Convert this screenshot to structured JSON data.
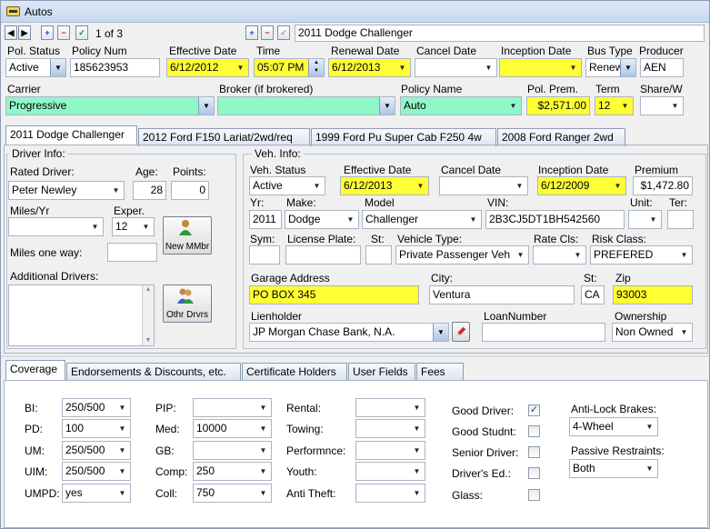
{
  "window": {
    "title": "Autos"
  },
  "nav": {
    "record_counter": "1 of 3",
    "vehicle_title": "2011 Dodge Challenger"
  },
  "policy": {
    "pol_status": {
      "label": "Pol. Status",
      "value": "Active"
    },
    "policy_num": {
      "label": "Policy Num",
      "value": "185623953"
    },
    "effective_date": {
      "label": "Effective Date",
      "value": "6/12/2012"
    },
    "time": {
      "label": "Time",
      "value": "05:07 PM"
    },
    "renewal_date": {
      "label": "Renewal Date",
      "value": "6/12/2013"
    },
    "cancel_date": {
      "label": "Cancel Date",
      "value": ""
    },
    "inception_date": {
      "label": "Inception Date",
      "value": ""
    },
    "bus_type": {
      "label": "Bus Type",
      "value": "Renew"
    },
    "producer": {
      "label": "Producer",
      "value": "AEN"
    },
    "carrier": {
      "label": "Carrier",
      "value": "Progressive"
    },
    "broker": {
      "label": "Broker (if brokered)",
      "value": ""
    },
    "policy_name": {
      "label": "Policy Name",
      "value": "Auto"
    },
    "pol_prem": {
      "label": "Pol. Prem.",
      "value": "$2,571.00"
    },
    "term": {
      "label": "Term",
      "value": "12"
    },
    "share": {
      "label": "Share/W",
      "value": ""
    }
  },
  "vehicle_tabs": [
    "2011 Dodge Challenger",
    "2012 Ford F150 Lariat/2wd/req",
    "1999 Ford Pu Super Cab F250 4w",
    "2008 Ford Ranger 2wd"
  ],
  "driver": {
    "group_title": "Driver Info:",
    "rated_driver": {
      "label": "Rated Driver:",
      "value": "Peter Newley"
    },
    "age": {
      "label": "Age:",
      "value": "28"
    },
    "points": {
      "label": "Points:",
      "value": "0"
    },
    "miles_yr": {
      "label": "Miles/Yr",
      "value": ""
    },
    "exper": {
      "label": "Exper.",
      "value": "12"
    },
    "new_mmbr_button": "New MMbr",
    "miles_one_way": {
      "label": "Miles one way:",
      "value": ""
    },
    "additional_drivers_label": "Additional Drivers:",
    "othr_drvrs_button": "Othr Drvrs"
  },
  "vehicle": {
    "group_title": "Veh. Info:",
    "veh_status": {
      "label": "Veh. Status",
      "value": "Active"
    },
    "effective_date": {
      "label": "Effective Date",
      "value": "6/12/2013"
    },
    "cancel_date": {
      "label": "Cancel Date",
      "value": ""
    },
    "inception_date": {
      "label": "Inception Date",
      "value": "6/12/2009"
    },
    "premium": {
      "label": "Premium",
      "value": "$1,472.80"
    },
    "yr": {
      "label": "Yr:",
      "value": "2011"
    },
    "make": {
      "label": "Make:",
      "value": "Dodge"
    },
    "model": {
      "label": "Model",
      "value": "Challenger"
    },
    "vin": {
      "label": "VIN:",
      "value": "2B3CJ5DT1BH542560"
    },
    "unit": {
      "label": "Unit:",
      "value": ""
    },
    "ter": {
      "label": "Ter:",
      "value": ""
    },
    "sym": {
      "label": "Sym:",
      "value": ""
    },
    "license_plate": {
      "label": "License Plate:",
      "value": ""
    },
    "st": {
      "label": "St:",
      "value": ""
    },
    "vehicle_type": {
      "label": "Vehicle Type:",
      "value": "Private Passenger Veh"
    },
    "rate_cls": {
      "label": "Rate Cls:",
      "value": ""
    },
    "risk_class": {
      "label": "Risk Class:",
      "value": "PREFERED"
    },
    "garage_address": {
      "label": "Garage Address",
      "value": "PO BOX 345"
    },
    "city": {
      "label": "City:",
      "value": "Ventura"
    },
    "garage_st": {
      "label": "St:",
      "value": "CA"
    },
    "zip": {
      "label": "Zip",
      "value": "93003"
    },
    "lienholder": {
      "label": "Lienholder",
      "value": "JP Morgan Chase Bank, N.A."
    },
    "loan_number": {
      "label": "LoanNumber",
      "value": ""
    },
    "ownership": {
      "label": "Ownership",
      "value": "Non Owned"
    }
  },
  "bottom_tabs": [
    "Coverage",
    "Endorsements & Discounts, etc.",
    "Certificate Holders",
    "User Fields",
    "Fees"
  ],
  "coverage": {
    "col1": [
      {
        "label": "BI:",
        "value": "250/500"
      },
      {
        "label": "PD:",
        "value": "100"
      },
      {
        "label": "UM:",
        "value": "250/500"
      },
      {
        "label": "UIM:",
        "value": "250/500"
      },
      {
        "label": "UMPD:",
        "value": "yes"
      }
    ],
    "col2": [
      {
        "label": "PIP:",
        "value": ""
      },
      {
        "label": "Med:",
        "value": "10000"
      },
      {
        "label": "GB:",
        "value": ""
      },
      {
        "label": "Comp:",
        "value": "250"
      },
      {
        "label": "Coll:",
        "value": "750"
      }
    ],
    "col3": [
      {
        "label": "Rental:",
        "value": ""
      },
      {
        "label": "Towing:",
        "value": ""
      },
      {
        "label": "Performnce:",
        "value": ""
      },
      {
        "label": "Youth:",
        "value": ""
      },
      {
        "label": "Anti Theft:",
        "value": ""
      }
    ],
    "checks": [
      {
        "label": "Good Driver:",
        "checked": true
      },
      {
        "label": "Good Studnt:",
        "checked": false
      },
      {
        "label": "Senior Driver:",
        "checked": false
      },
      {
        "label": "Driver's Ed.:",
        "checked": false
      },
      {
        "label": "Glass:",
        "checked": false
      }
    ],
    "anti_lock": {
      "label": "Anti-Lock Brakes:",
      "value": "4-Wheel"
    },
    "passive": {
      "label": "Passive Restraints:",
      "value": "Both"
    }
  },
  "icons": {
    "window": "car-folder-icon",
    "nav_first": "first-record-icon",
    "nav_last": "last-record-icon",
    "add": "plus-icon",
    "delete": "minus-icon",
    "save": "checkmark-icon",
    "edit": "pencil-icon",
    "person": "person-icon"
  }
}
